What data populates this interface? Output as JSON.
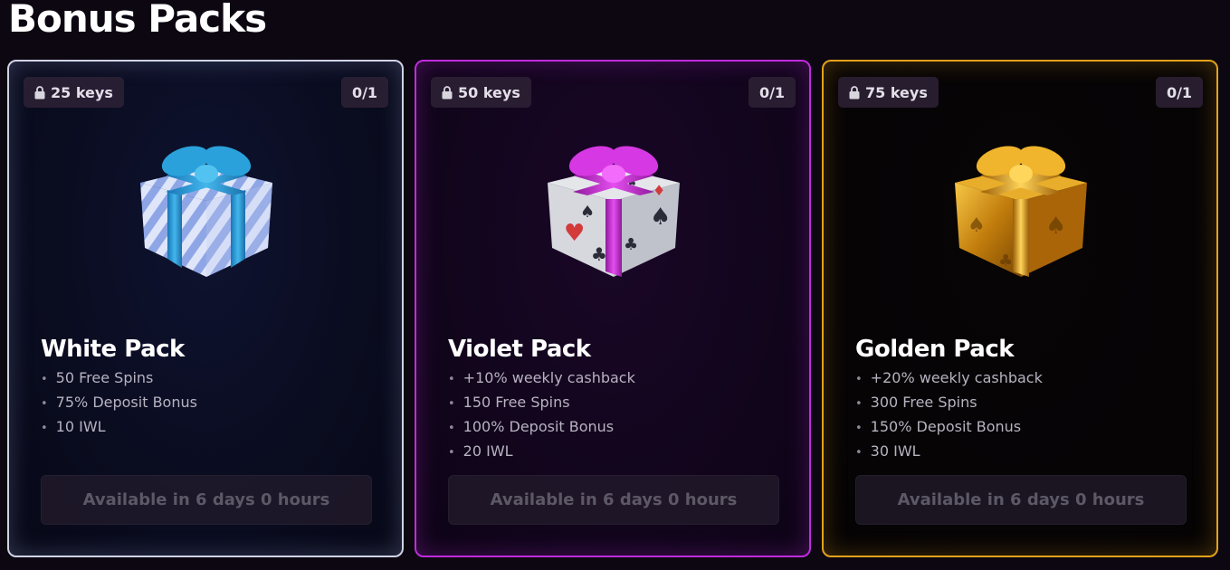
{
  "page": {
    "title": "Bonus Packs"
  },
  "packs": [
    {
      "id": "white",
      "keys": "25 keys",
      "count": "0/1",
      "name": "White Pack",
      "perks": [
        "50 Free Spins",
        "75% Deposit Bonus",
        "10 IWL"
      ],
      "button_label": "Available in 6 days 0 hours",
      "icon": "gift-icon",
      "border_color": "#cfd3e6"
    },
    {
      "id": "violet",
      "keys": "50 keys",
      "count": "0/1",
      "name": "Violet Pack",
      "perks": [
        "+10% weekly cashback",
        "150 Free Spins",
        "100% Deposit Bonus",
        "20 IWL"
      ],
      "button_label": "Available in 6 days 0 hours",
      "icon": "gift-icon",
      "border_color": "#c02cdd"
    },
    {
      "id": "golden",
      "keys": "75 keys",
      "count": "0/1",
      "name": "Golden Pack",
      "perks": [
        "+20% weekly cashback",
        "300 Free Spins",
        "150% Deposit Bonus",
        "30 IWL"
      ],
      "button_label": "Available in 6 days 0 hours",
      "icon": "gift-icon",
      "border_color": "#e3a21b"
    }
  ]
}
